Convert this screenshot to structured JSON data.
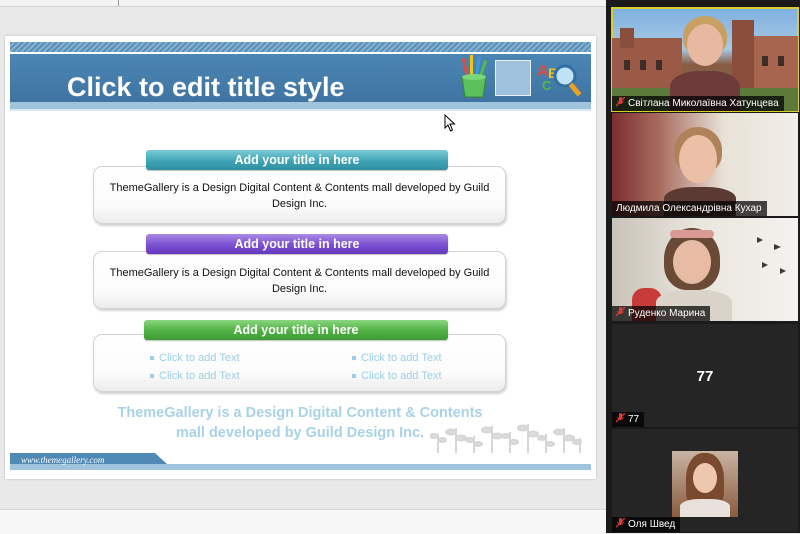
{
  "slide": {
    "title": "Click to edit title style",
    "sections": [
      {
        "header": "Add your title in here",
        "color": "#3ea4b5",
        "body": "ThemeGallery  is a Design Digital Content & Contents mall developed by Guild Design Inc."
      },
      {
        "header": "Add your title in here",
        "color": "#7b4fd0",
        "body": "ThemeGallery  is a Design Digital Content & Contents mall developed by Guild Design Inc."
      },
      {
        "header": "Add your title in here",
        "color": "#4fb043",
        "bullets": [
          "Click to add Text",
          "Click to add Text",
          "Click to add Text",
          "Click to add Text"
        ]
      }
    ],
    "tagline_line1": "ThemeGallery  is a Design Digital Content & Contents",
    "tagline_line2": "mall developed by Guild Design Inc.",
    "footer_url": "www.themegallery.com"
  },
  "participants": [
    {
      "name": "Світлана Миколаївна Хатунцева",
      "muted": true,
      "active_speaker": true
    },
    {
      "name": "Людмила Олександрівна Кухар",
      "muted": false
    },
    {
      "name": "Руденко Марина",
      "muted": true
    },
    {
      "name": "77",
      "display_text": "77",
      "muted": true
    },
    {
      "name": "Оля Швед",
      "muted": true
    }
  ],
  "colors": {
    "accent_blue": "#4b86b5",
    "muted_red": "#e03a3a",
    "active_border": "#d8cf2f"
  }
}
